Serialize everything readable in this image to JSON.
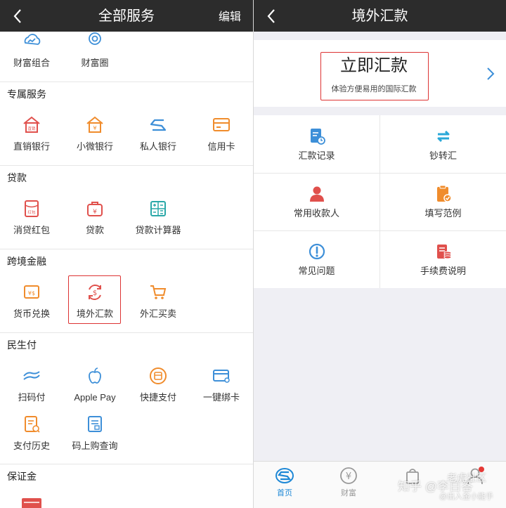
{
  "left": {
    "title": "全部服务",
    "edit_label": "编辑",
    "top_items": [
      {
        "label": "财富组合"
      },
      {
        "label": "财富圈"
      }
    ],
    "sections": [
      {
        "title": "专属服务",
        "items": [
          {
            "label": "直销银行"
          },
          {
            "label": "小微银行"
          },
          {
            "label": "私人银行"
          },
          {
            "label": "信用卡"
          }
        ]
      },
      {
        "title": "贷款",
        "items": [
          {
            "label": "消贷红包"
          },
          {
            "label": "贷款"
          },
          {
            "label": "贷款计算器"
          }
        ]
      },
      {
        "title": "跨境金融",
        "items": [
          {
            "label": "货币兑换"
          },
          {
            "label": "境外汇款"
          },
          {
            "label": "外汇买卖"
          }
        ]
      },
      {
        "title": "民生付",
        "items": [
          {
            "label": "扫码付"
          },
          {
            "label": "Apple Pay"
          },
          {
            "label": "快捷支付"
          },
          {
            "label": "一键绑卡"
          },
          {
            "label": "支付历史"
          },
          {
            "label": "码上购查询"
          }
        ]
      },
      {
        "title": "保证金",
        "items": []
      }
    ],
    "icon_text": {
      "direct_bank": "直销",
      "red_packet": "红包",
      "exchange": "¥$"
    }
  },
  "right": {
    "title": "境外汇款",
    "hero": {
      "title": "立即汇款",
      "subtitle": "体验方便易用的国际汇款"
    },
    "grid": [
      {
        "label": "汇款记录"
      },
      {
        "label": "钞转汇"
      },
      {
        "label": "常用收款人"
      },
      {
        "label": "填写范例"
      },
      {
        "label": "常见问题"
      },
      {
        "label": "手续费说明"
      }
    ],
    "tabs": [
      {
        "label": "首页"
      },
      {
        "label": "财富"
      },
      {
        "label": ""
      },
      {
        "label": ""
      }
    ]
  },
  "watermarks": {
    "zhihu": "知乎 @李白答",
    "community": "老虎社区",
    "account": "@出入金小能手"
  },
  "colors": {
    "accent_blue": "#3d8fd8",
    "orange": "#f08c2c",
    "red": "#e0504c",
    "highlight": "#d33",
    "nav_bg": "#2c2c2c"
  }
}
